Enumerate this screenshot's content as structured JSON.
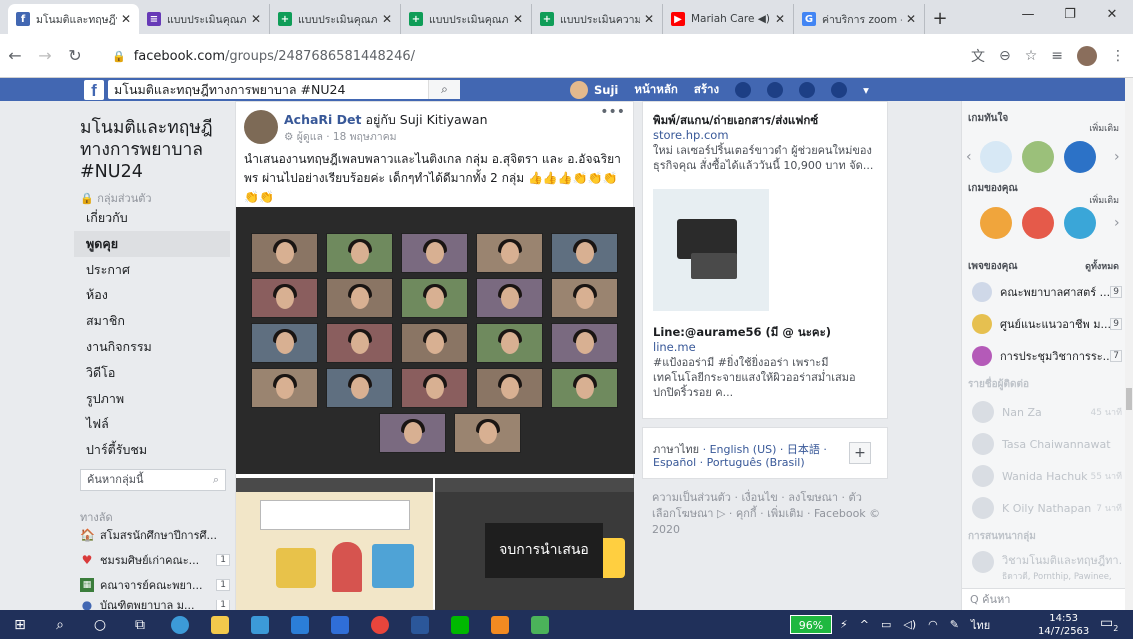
{
  "browser": {
    "tabs": [
      {
        "label": "มโนมติและทฤษฎีท",
        "color": "#4267b2",
        "glyph": "f"
      },
      {
        "label": "แบบประเมินคุณภาพ",
        "color": "#673ab7",
        "glyph": "≡"
      },
      {
        "label": "แบบประเมินคุณภาพ",
        "color": "#0f9d58",
        "glyph": "+"
      },
      {
        "label": "แบบประเมินคุณภาพ",
        "color": "#0f9d58",
        "glyph": "+"
      },
      {
        "label": "แบบประเมินความพึง",
        "color": "#0f9d58",
        "glyph": "+"
      },
      {
        "label": "Mariah Care  ◀)",
        "color": "#ff0000",
        "glyph": "▶"
      },
      {
        "label": "ค่าบริการ zoom -",
        "color": "#4285f4",
        "glyph": "G"
      }
    ],
    "new_tab": "+",
    "url_domain": "facebook.com",
    "url_path": "/groups/2487686581448246/"
  },
  "fb": {
    "search_value": "มโนมติและทฤษฎีทางการพยาบาล #NU24",
    "user_name": "Suji",
    "nav_home": "หน้าหลัก",
    "nav_create": "สร้าง"
  },
  "group": {
    "title": "มโนมติและทฤษฎีทางการพยาบาล #NU24",
    "privacy": "🔒 กลุ่มส่วนตัว",
    "nav": [
      "เกี่ยวกับ",
      "พูดคุย",
      "ประกาศ",
      "ห้อง",
      "สมาชิก",
      "งานกิจกรรม",
      "วิดีโอ",
      "รูปภาพ",
      "ไฟล์",
      "ปาร์ตี้รับชม"
    ],
    "search_placeholder": "ค้นหากลุ่มนี้",
    "shortcuts_heading": "ทางลัด",
    "shortcuts": [
      {
        "label": "สโมสรนักศึกษาปีการศึ...",
        "icon": "🏠",
        "count": ""
      },
      {
        "label": "ชมรมศิษย์เก่าคณะ...",
        "icon": "💔",
        "count": "1"
      },
      {
        "label": "คณาจารย์คณะพยา...",
        "icon": "▦",
        "count": "1"
      },
      {
        "label": "บัณฑิตพยาบาล ม...",
        "icon": "●",
        "count": "1"
      }
    ]
  },
  "post": {
    "author": "AchaRi Det",
    "with_text": "อยู่กับ Suji Kitiyawan",
    "meta": "⚙ ผู้ดูแล · 18 พฤษภาคม",
    "more": "•••",
    "body": "นำเสนองานทฤษฎีเพลบพลาวและไนติงเกล กลุ่ม อ.สุจิตรา และ อ.อัจฉริยาพร ผ่านไปอย่างเรียบร้อยค่ะ เด็กๆทำได้ดีมากทั้ง 2 กลุ่ม 👍👍👍👏👏👏👏👏",
    "end_presentation": "จบการนำเสนอ"
  },
  "ads": [
    {
      "title": "พิมพ์/สแกน/ถ่ายเอกสาร/ส่งแฟกซ์",
      "domain": "store.hp.com",
      "desc": "ใหม่ เลเซอร์ปริ้นเตอร์ขาวดำ ผู้ช่วยคนใหม่ของธุรกิจคุณ สั่งซื้อได้แล้ววันนี้ 10,900 บาท จัด..."
    },
    {
      "title": "Line:@aurame56 (มี @ นะคะ)",
      "domain": "line.me",
      "desc": "#แป้งออร่ามี #ยิ่งใช้ยิ่งออร่า เพราะมีเทคโนโลยีกระจายแสงให้ผิวออร่าสม่ำเสมอ ปกปิดริ้วรอย ค..."
    }
  ],
  "language": {
    "current": "ภาษาไทย",
    "others_1": "· English (US) · 日本語 ·",
    "others_2": "Español · Português (Brasil)",
    "plus": "+"
  },
  "footer": "ความเป็นส่วนตัว · เงื่อนไข · ลงโฆษณา · ตัวเลือกโฆษณา ▷ · คุกกี้ · เพิ่มเติม · Facebook © 2020",
  "right": {
    "games_heading": "เกมทันใจ",
    "games_more": "เพิ่มเติม",
    "my_games_heading": "เกมของคุณ",
    "my_games_more": "เพิ่มเติม",
    "pages_heading": "เพจของคุณ",
    "pages_more": "ดูทั้งหมด",
    "pages": [
      {
        "name": "คณะพยาบาลศาสตร์ ...",
        "n": "9"
      },
      {
        "name": "ศูนย์แนะแนวอาชีพ ม...",
        "n": "9"
      },
      {
        "name": "การประชุมวิชาการระ...",
        "n": "7"
      }
    ],
    "contacts_heading": "รายชื่อผู้ติดต่อ",
    "contacts": [
      {
        "name": "Nan Za",
        "time": "45 นาที"
      },
      {
        "name": "Tasa Chaiwannawat",
        "time": ""
      },
      {
        "name": "Wanida Hachuk",
        "time": "55 นาที"
      },
      {
        "name": "K Oily Nathapan",
        "time": "7 นาที"
      }
    ],
    "group_chats_heading": "การสนทนากลุ่ม",
    "group_chat": "วิชามโนมติและทฤษฎีทา...",
    "group_chat_sub": "ธิดาวดี, Pornthip, Pawinee,",
    "search": "Q ค้นหา"
  },
  "taskbar": {
    "battery": "96%",
    "lang": "ไทย",
    "time": "14:53",
    "date": "14/7/2563",
    "notif_count": "2"
  }
}
